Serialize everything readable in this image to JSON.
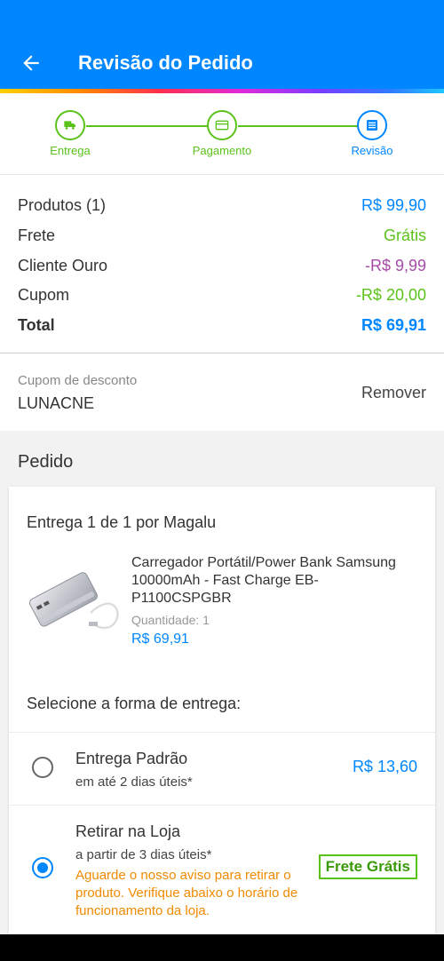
{
  "header": {
    "title": "Revisão do Pedido",
    "back_icon": "arrow-left-icon"
  },
  "stepper": {
    "steps": [
      {
        "label": "Entrega",
        "icon": "truck-icon",
        "state": "done"
      },
      {
        "label": "Pagamento",
        "icon": "card-icon",
        "state": "done"
      },
      {
        "label": "Revisão",
        "icon": "document-icon",
        "state": "active"
      }
    ],
    "colors": {
      "done": "#5ac31a",
      "active": "#0086ff"
    }
  },
  "summary": {
    "products": {
      "label": "Produtos (1)",
      "value": "R$ 99,90"
    },
    "shipping": {
      "label": "Frete",
      "value": "Grátis"
    },
    "gold": {
      "label": "Cliente Ouro",
      "value": "-R$ 9,99"
    },
    "coupon": {
      "label": "Cupom",
      "value": "-R$ 20,00"
    },
    "total": {
      "label": "Total",
      "value": "R$ 69,91"
    }
  },
  "coupon_box": {
    "caption": "Cupom de desconto",
    "code": "LUNACNE",
    "remove_label": "Remover"
  },
  "order": {
    "section_title": "Pedido",
    "delivery_title": "Entrega 1 de 1 por Magalu",
    "product": {
      "name": "Carregador Portátil/Power Bank Samsung 10000mAh - Fast Charge EB-P1100CSPGBR",
      "quantity": "Quantidade:  1",
      "price": "R$ 69,91"
    },
    "select_title": "Selecione a forma de entrega:",
    "options": [
      {
        "title": "Entrega Padrão",
        "subtitle": "em até 2 dias úteis*",
        "price": "R$ 13,60",
        "selected": false
      },
      {
        "title": "Retirar na Loja",
        "subtitle": "a partir de 3 dias úteis*",
        "warning": "Aguarde o nosso aviso para retirar o produto. Verifique abaixo o horário de funcionamento da loja.",
        "badge": "Frete Grátis",
        "selected": true
      }
    ]
  }
}
